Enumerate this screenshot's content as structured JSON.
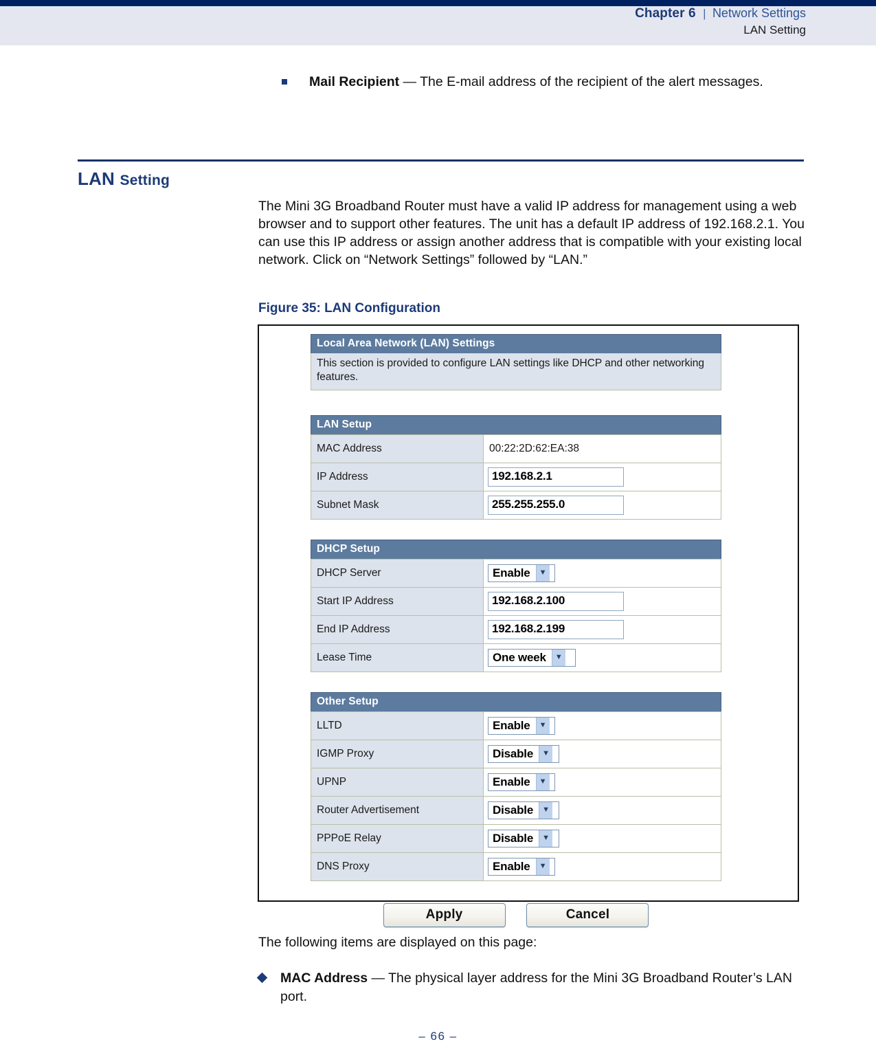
{
  "header": {
    "chapter_label": "Chapter",
    "chapter_number": "6",
    "separator": "|",
    "chapter_title": "Network Settings",
    "subtitle": "LAN Setting"
  },
  "top_bullet": {
    "term": "Mail Recipient",
    "dash": " — ",
    "description": "The E-mail address of the recipient of the alert messages."
  },
  "section": {
    "title_main": "LAN",
    "title_rest": "Setting",
    "intro": "The Mini 3G Broadband Router must have a valid IP address for management using a web browser and to support other features. The unit has a default IP address of 192.168.2.1. You can use this IP address or assign another address that is compatible with your existing local network. Click on “Network Settings” followed by “LAN.”",
    "figure_caption": "Figure 35:  LAN Configuration"
  },
  "figure": {
    "intro_panel": {
      "title": "Local Area Network (LAN) Settings",
      "description": "This section is provided to configure LAN settings like DHCP and other networking features."
    },
    "lan_setup": {
      "title": "LAN Setup",
      "rows": [
        {
          "label": "MAC Address",
          "value": "00:22:2D:62:EA:38",
          "control": "text"
        },
        {
          "label": "IP Address",
          "value": "192.168.2.1",
          "control": "input"
        },
        {
          "label": "Subnet Mask",
          "value": "255.255.255.0",
          "control": "input"
        }
      ]
    },
    "dhcp_setup": {
      "title": "DHCP Setup",
      "rows": [
        {
          "label": "DHCP Server",
          "value": "Enable",
          "control": "select"
        },
        {
          "label": "Start IP Address",
          "value": "192.168.2.100",
          "control": "input"
        },
        {
          "label": "End IP Address",
          "value": "192.168.2.199",
          "control": "input"
        },
        {
          "label": "Lease Time",
          "value": "One week",
          "control": "select"
        }
      ]
    },
    "other_setup": {
      "title": "Other Setup",
      "rows": [
        {
          "label": "LLTD",
          "value": "Enable",
          "control": "select"
        },
        {
          "label": "IGMP Proxy",
          "value": "Disable",
          "control": "select"
        },
        {
          "label": "UPNP",
          "value": "Enable",
          "control": "select"
        },
        {
          "label": "Router Advertisement",
          "value": "Disable",
          "control": "select"
        },
        {
          "label": "PPPoE Relay",
          "value": "Disable",
          "control": "select"
        },
        {
          "label": "DNS Proxy",
          "value": "Enable",
          "control": "select"
        }
      ]
    },
    "buttons": {
      "apply": "Apply",
      "cancel": "Cancel"
    },
    "dropdown_glyph": "▼"
  },
  "lower": {
    "lead_in": "The following items are displayed on this page:",
    "bullet": {
      "term": "MAC Address",
      "dash": " — ",
      "description": "The physical layer address for the Mini 3G Broadband Router’s LAN port."
    }
  },
  "footer": {
    "page_number": "–  66  –"
  },
  "colors": {
    "navy_rule": "#002060",
    "header_band": "#e4e7f0",
    "heading_blue": "#1d3a78",
    "panel_header": "#5c7b9e",
    "label_cell": "#dde3ec",
    "select_arrow": "#bfd3ef"
  }
}
